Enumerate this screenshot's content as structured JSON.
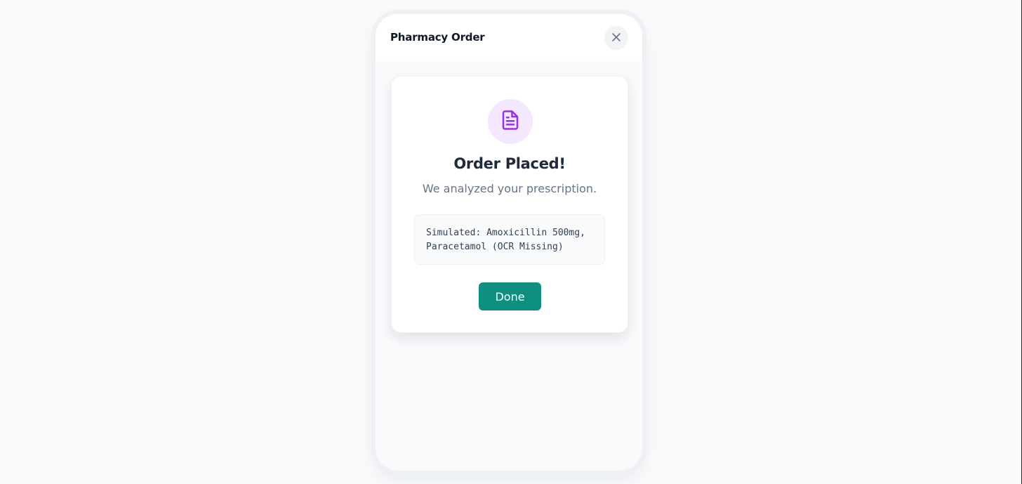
{
  "header": {
    "title": "Pharmacy Order",
    "close_icon": "close-icon"
  },
  "card": {
    "icon": "document-icon",
    "title": "Order Placed!",
    "subtitle": "We analyzed your prescription.",
    "result_line1": "Simulated: Amoxicillin 500mg,",
    "result_line2": "Paracetamol (OCR Missing)",
    "done_label": "Done"
  },
  "colors": {
    "accent": "#0f8f80",
    "icon_purple": "#9333ea",
    "icon_bg": "#f3e8ff"
  }
}
